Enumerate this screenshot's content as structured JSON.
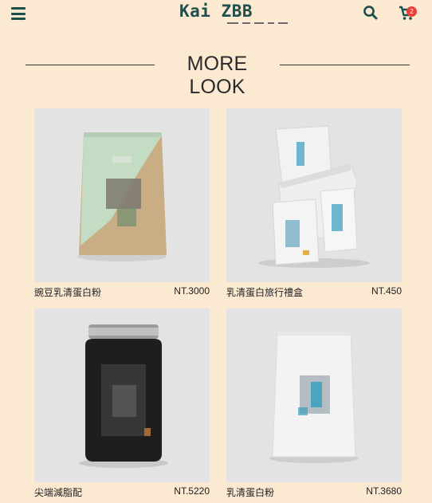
{
  "header": {
    "brand": "Kai ZBB",
    "cart_count": "2",
    "icons": [
      "menu-icon",
      "search-icon",
      "cart-icon"
    ]
  },
  "section": {
    "title": "MORE LOOK"
  },
  "products": [
    {
      "name": "豌豆乳清蛋白粉",
      "price": "NT.3000"
    },
    {
      "name": "乳清蛋白旅行禮盒",
      "price": "NT.450"
    },
    {
      "name": "尖端減脂配",
      "price": "NT.5220"
    },
    {
      "name": "乳清蛋白粉",
      "price": "NT.3680"
    }
  ],
  "colors": {
    "background": "#fbe9d2",
    "brand": "#1f4f4a",
    "badge": "#e8403a",
    "image_bg": "#e3e3e3"
  }
}
